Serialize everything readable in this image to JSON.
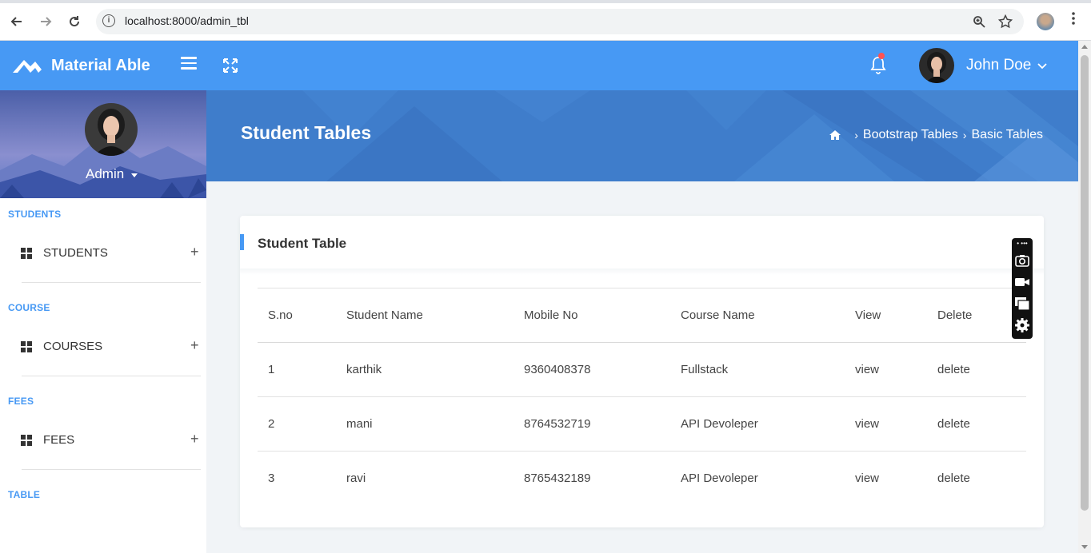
{
  "browser": {
    "url": "localhost:8000/admin_tbl"
  },
  "header": {
    "logo_text": "Material Able",
    "user_name": "John Doe"
  },
  "sidebar": {
    "profile_name": "Admin",
    "sections": [
      {
        "title": "STUDENTS",
        "item": "STUDENTS"
      },
      {
        "title": "COURSE",
        "item": "COURSES"
      },
      {
        "title": "FEES",
        "item": "FEES"
      },
      {
        "title": "TABLE"
      }
    ]
  },
  "banner": {
    "title": "Student Tables",
    "breadcrumb": [
      "Bootstrap Tables",
      "Basic Tables"
    ]
  },
  "card": {
    "title": "Student Table",
    "columns": [
      "S.no",
      "Student Name",
      "Mobile No",
      "Course Name",
      "View",
      "Delete"
    ],
    "rows": [
      [
        "1",
        "karthik",
        "9360408378",
        "Fullstack",
        "view",
        "delete"
      ],
      [
        "2",
        "mani",
        "8764532719",
        "API Devoleper",
        "view",
        "delete"
      ],
      [
        "3",
        "ravi",
        "8765432189",
        "API Devoleper",
        "view",
        "delete"
      ]
    ]
  },
  "colors": {
    "header_blue": "#4799f4",
    "banner_blue": "#3f7dcb",
    "page_bg": "#f1f4f7"
  }
}
